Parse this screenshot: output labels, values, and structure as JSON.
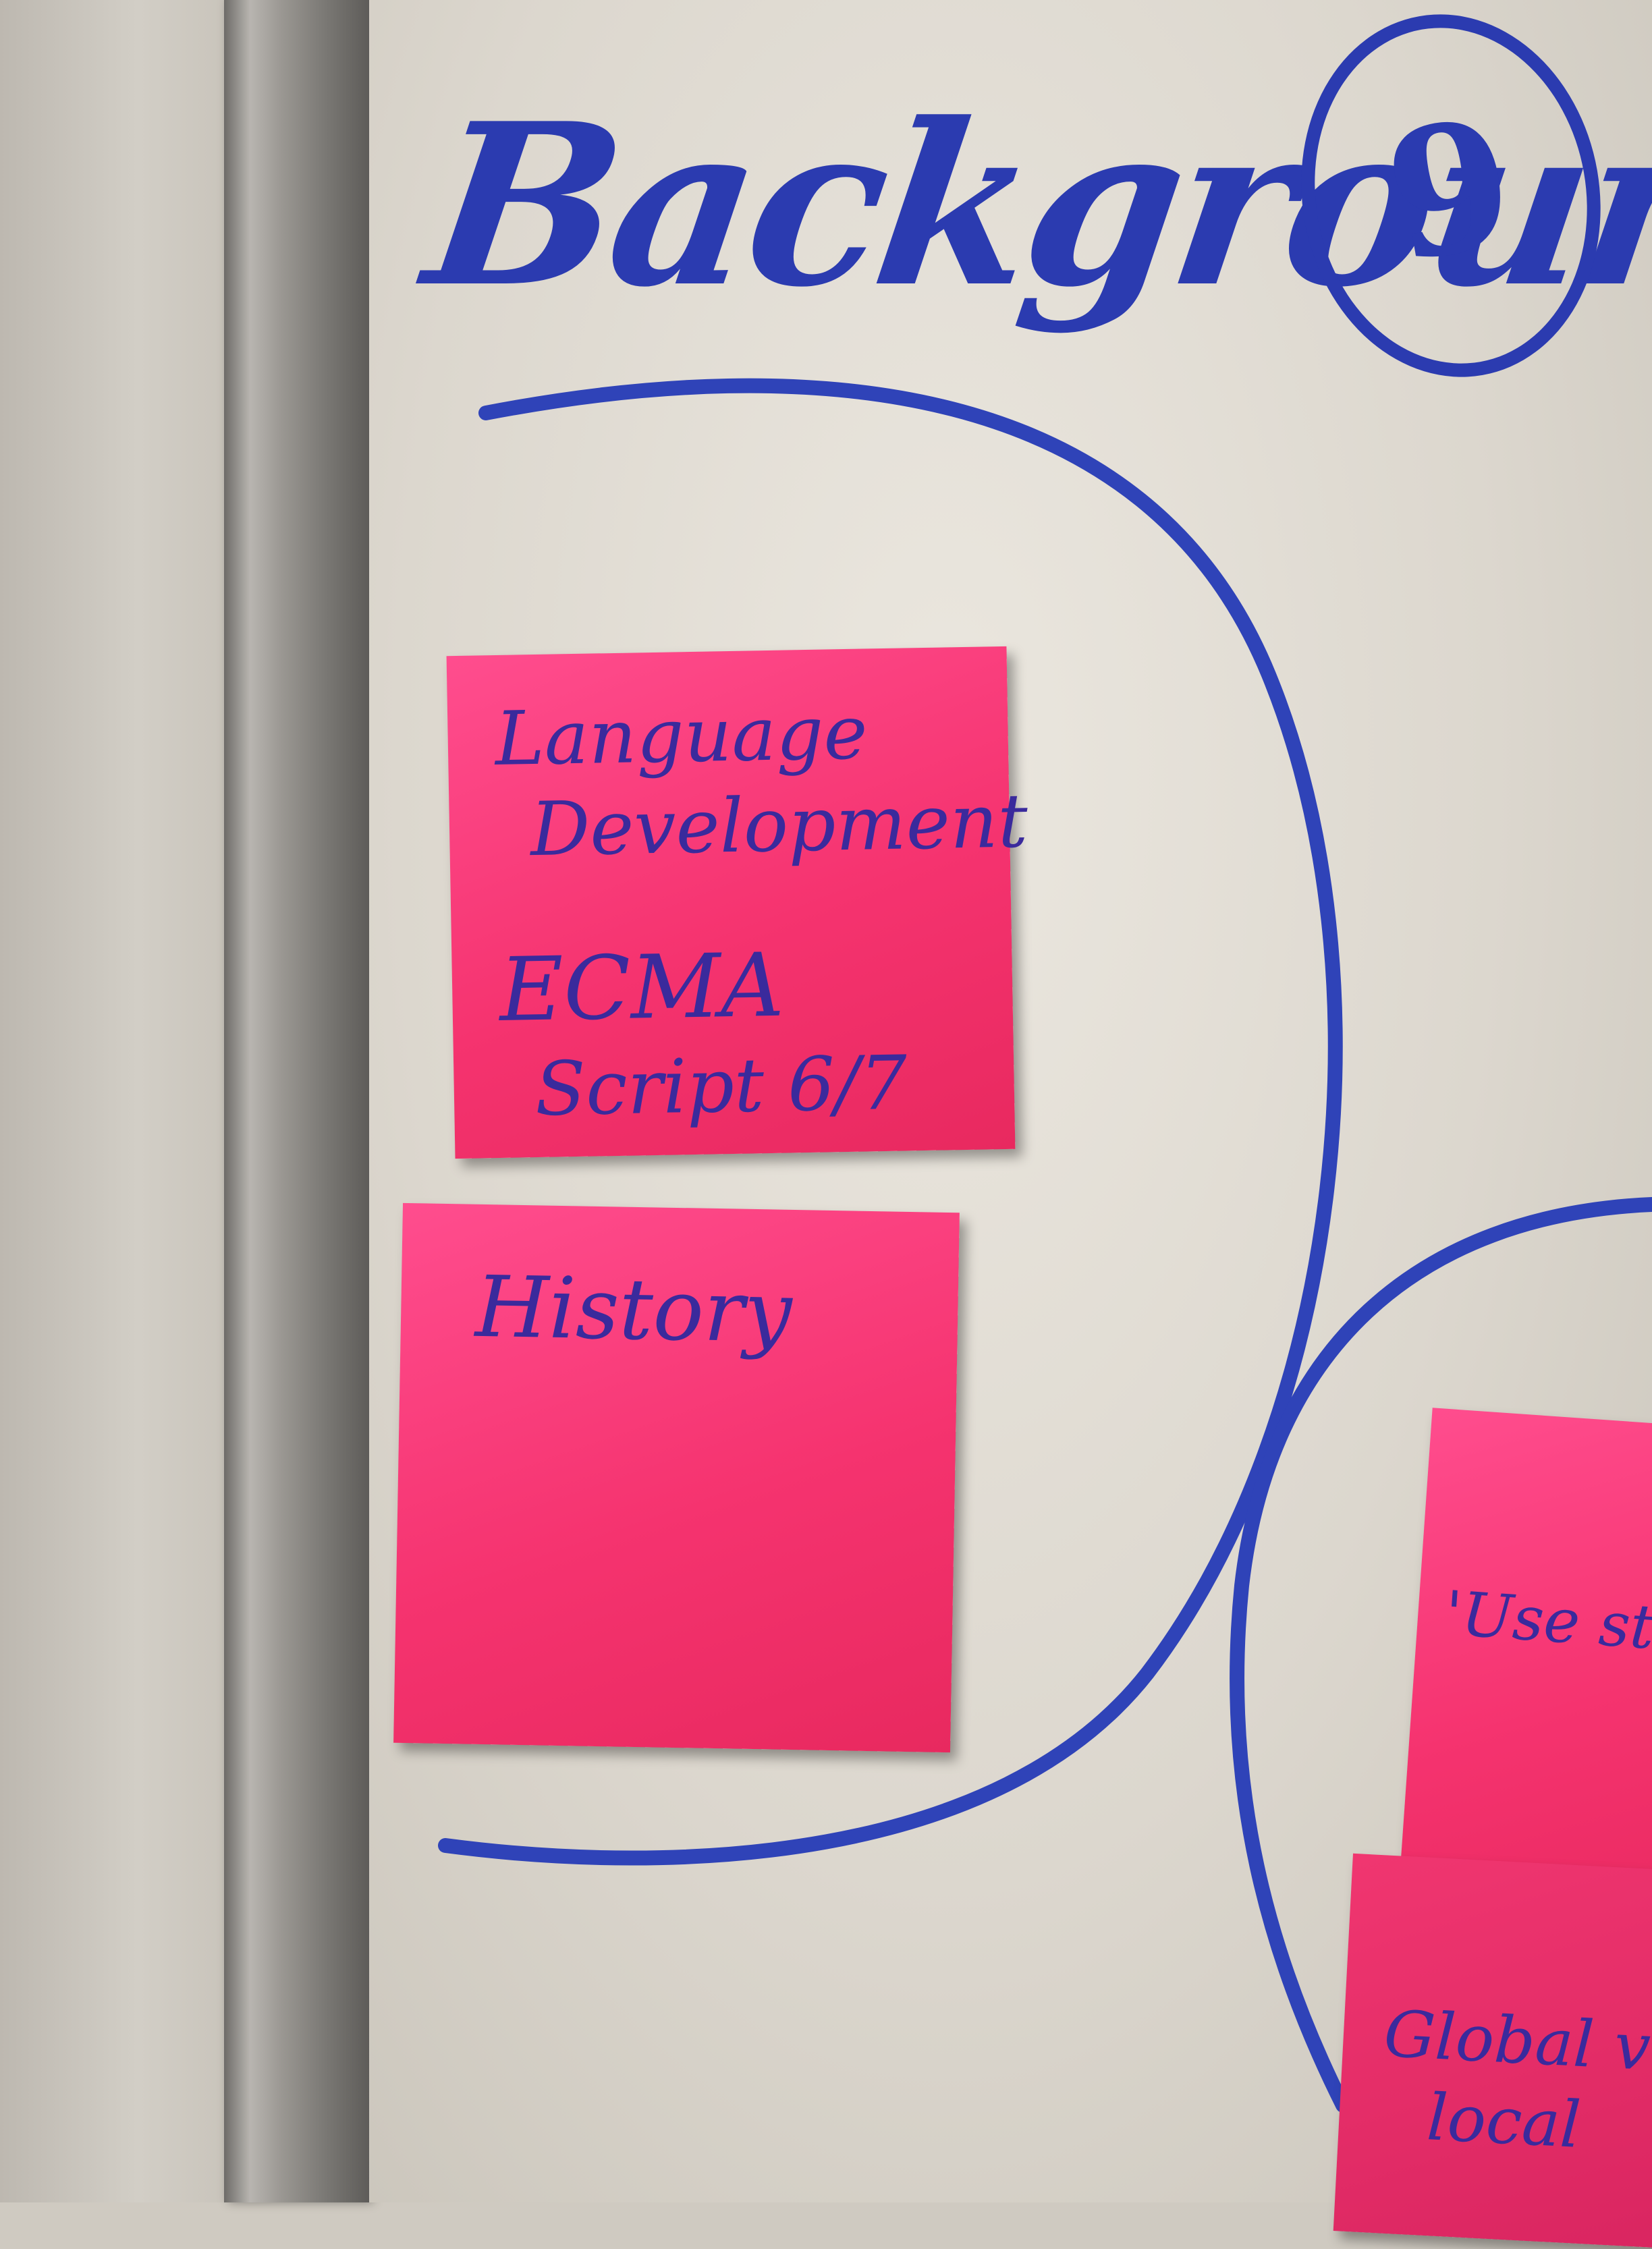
{
  "whiteboard": {
    "title": "Background",
    "circled_number": "9"
  },
  "notes": {
    "language": {
      "line1": "Language",
      "line2": "Development",
      "line3": "ECMA",
      "line4": "Script 6/7"
    },
    "history": {
      "text": "History"
    },
    "right_top": {
      "text": "'Use stri"
    },
    "right_bottom": {
      "line1": "Global v",
      "line2": "local"
    }
  },
  "colors": {
    "marker": "#2b3bb0",
    "sticky_note": "#f5336f",
    "board": "#dcd7ce",
    "frame": "#9a9792"
  }
}
